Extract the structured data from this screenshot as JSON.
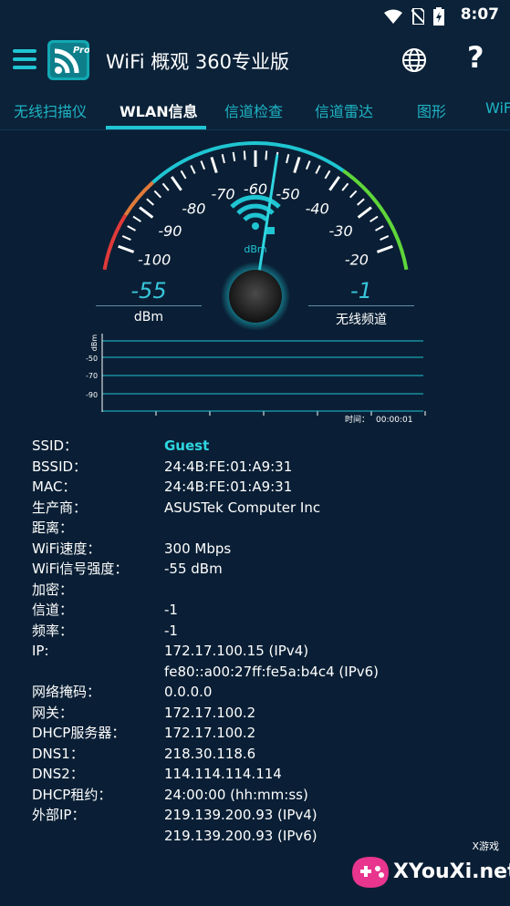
{
  "status": {
    "time": "8:07"
  },
  "app": {
    "title": "WiFi 概观 360专业版",
    "logo_label": "Pro"
  },
  "tabs": [
    {
      "label": "无线扫描仪"
    },
    {
      "label": "WLAN信息"
    },
    {
      "label": "信道检查"
    },
    {
      "label": "信道雷达"
    },
    {
      "label": "图形"
    },
    {
      "label": "WiF"
    }
  ],
  "gauge": {
    "ticks": [
      "-100",
      "-90",
      "-80",
      "-70",
      "-60",
      "-50",
      "-40",
      "-30",
      "-20"
    ],
    "unit": "dBm",
    "value": -55,
    "left_value": "-55",
    "left_label": "dBm",
    "right_value": "-1",
    "right_label": "无线频道"
  },
  "graph": {
    "y_unit": "dBm",
    "y_ticks": [
      "-50",
      "-70",
      "-90"
    ],
    "time_label": "时间：",
    "time_value": "00:00:01"
  },
  "info": {
    "ssid_label": "SSID：",
    "ssid": "Guest",
    "bssid_label": "BSSID：",
    "bssid": "24:4B:FE:01:A9:31",
    "mac_label": "MAC：",
    "mac": "24:4B:FE:01:A9:31",
    "vendor_label": "生产商：",
    "vendor": "ASUSTek Computer Inc",
    "distance_label": "距离：",
    "distance": "",
    "speed_label": "WiFi速度：",
    "speed": "300 Mbps",
    "signal_label": "WiFi信号强度：",
    "signal": "-55 dBm",
    "encryption_label": "加密：",
    "encryption": "",
    "channel_label": "信道：",
    "channel": "-1",
    "frequency_label": "频率：",
    "frequency": "-1",
    "ip_label": "IP:",
    "ip_v4": "172.17.100.15 (IPv4)",
    "ip_v6": "fe80::a00:27ff:fe5a:b4c4 (IPv6)",
    "netmask_label": "网络掩码：",
    "netmask": "0.0.0.0",
    "gateway_label": "网关：",
    "gateway": "172.17.100.2",
    "dhcp_label": "DHCP服务器：",
    "dhcp": "172.17.100.2",
    "dns1_label": "DNS1：",
    "dns1": "218.30.118.6",
    "dns2_label": "DNS2：",
    "dns2": "114.114.114.114",
    "lease_label": "DHCP租约：",
    "lease": "24:00:00 (hh:mm:ss)",
    "external_label": "外部IP：",
    "external_v4": "219.139.200.93 (IPv4)",
    "external_v6": "219.139.200.93 (IPv6)"
  },
  "watermark": {
    "text": "XYouXi.net",
    "small": "X游戏"
  },
  "colors": {
    "accent": "#1fc5d2",
    "background": "#0a1f35",
    "bar": "#0b2238"
  }
}
